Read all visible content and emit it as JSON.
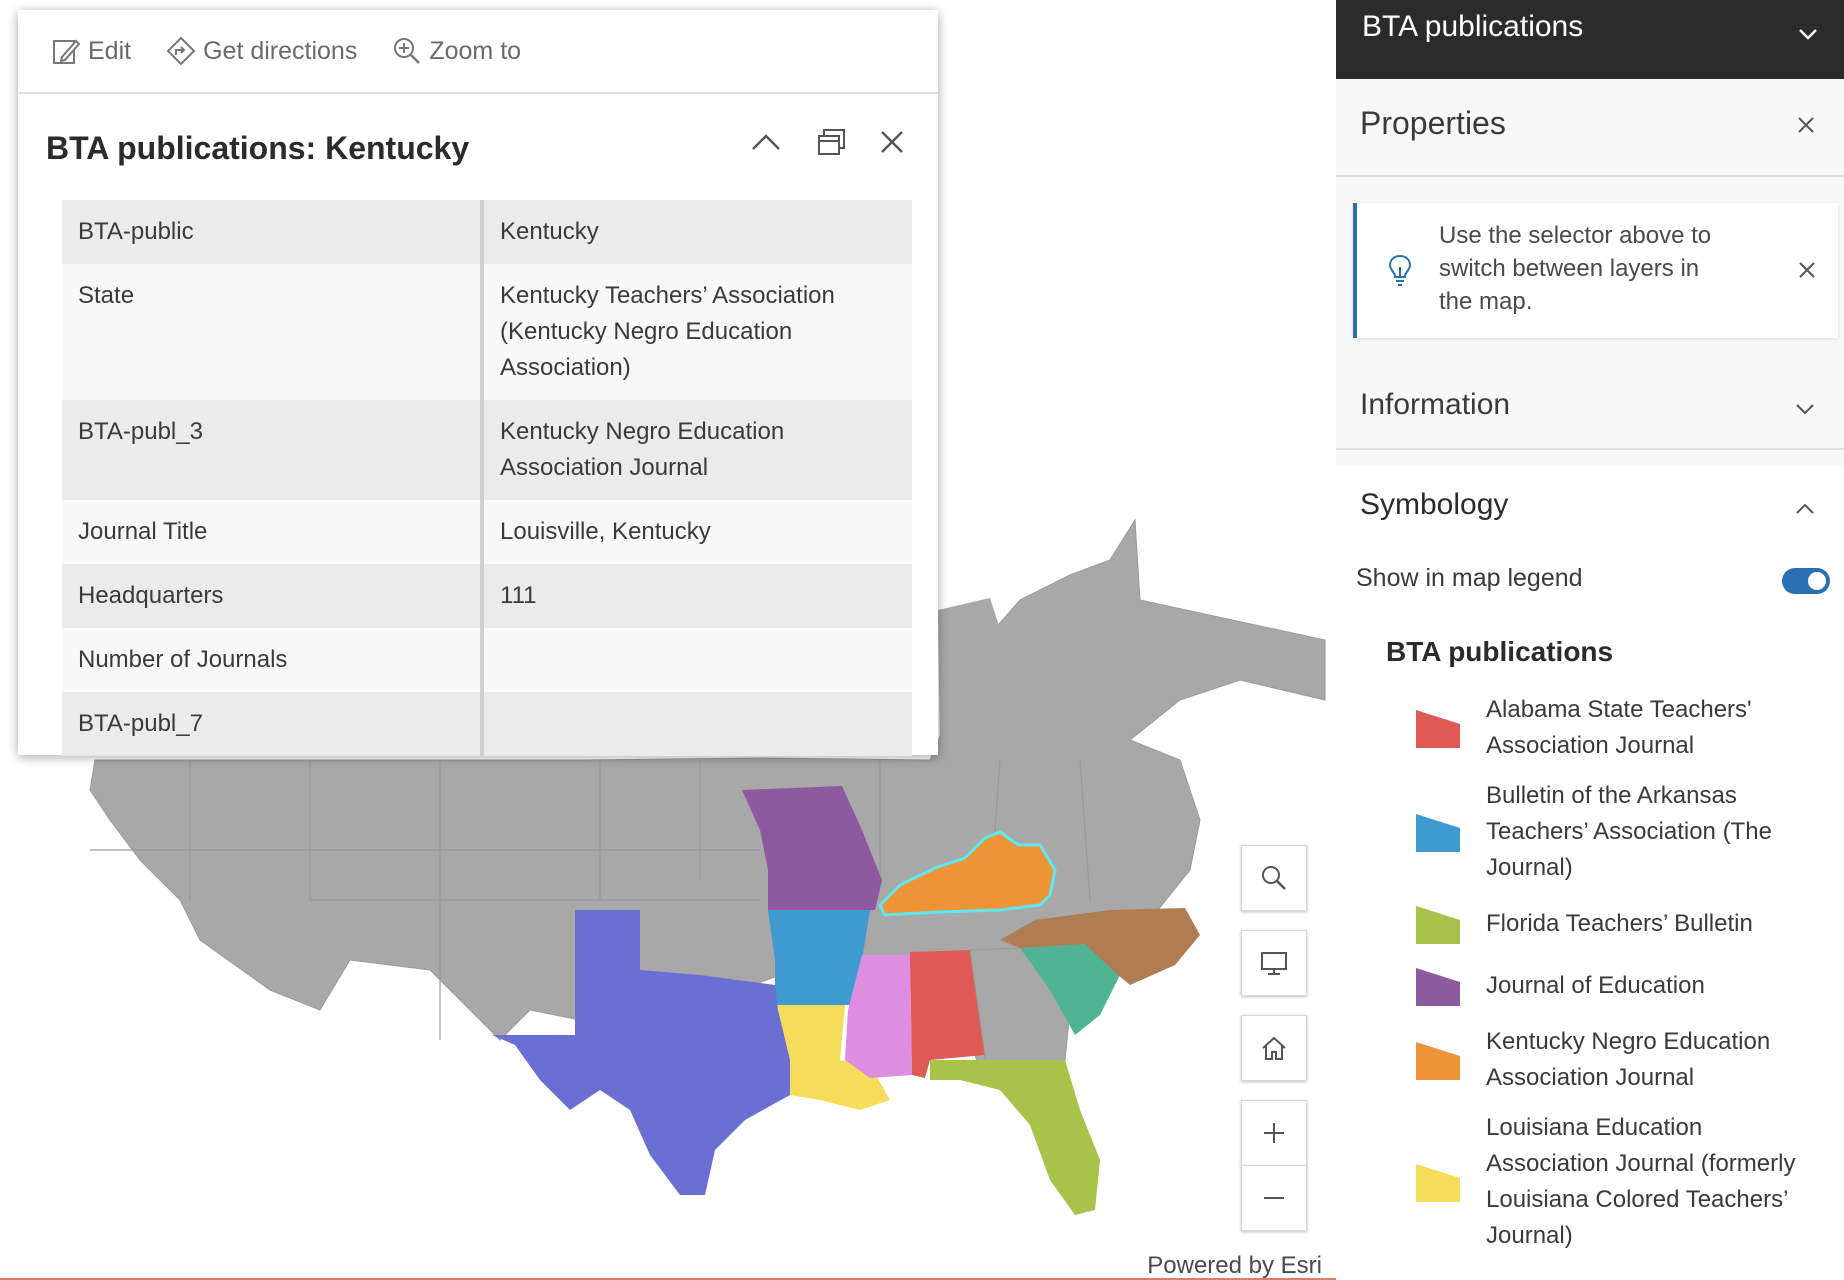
{
  "popup": {
    "actions": {
      "edit": "Edit",
      "directions": "Get directions",
      "zoom": "Zoom to"
    },
    "title": "BTA publications: Kentucky",
    "rows": [
      {
        "key": "BTA-public",
        "value": "Kentucky"
      },
      {
        "key": "State",
        "value": "Kentucky Teachers’ Association (Kentucky Negro Education Association)"
      },
      {
        "key": "BTA-publ_3",
        "value": "Kentucky Negro Education Association Journal"
      },
      {
        "key": "Journal Title",
        "value": "Louisville, Kentucky"
      },
      {
        "key": "Headquarters",
        "value": "111"
      },
      {
        "key": "Number of Journals",
        "value": ""
      },
      {
        "key": "BTA-publ_7",
        "value": ""
      }
    ]
  },
  "map": {
    "attribution": "Powered by Esri",
    "controls": [
      "search-icon",
      "monitor-icon",
      "home-icon",
      "plus-icon",
      "minus-icon"
    ],
    "base_color": "#a8a8a8",
    "highlight_outline": "#5ee8f0"
  },
  "panel": {
    "layer_selector": "BTA publications",
    "properties": "Properties",
    "tip": "Use the selector above to switch between layers in the map.",
    "information": "Information",
    "symbology": "Symbology",
    "show_in_legend": "Show in map legend",
    "show_in_legend_on": true,
    "legend_title": "BTA publications",
    "legend": [
      {
        "label": "Alabama State Teachers' Association Journal",
        "color": "#e05a55"
      },
      {
        "label": "Bulletin of the Arkansas Teachers’ Association (The Journal)",
        "color": "#3e9ad0"
      },
      {
        "label": "Florida Teachers’ Bulletin",
        "color": "#a8c24a"
      },
      {
        "label": "Journal of Education",
        "color": "#8d5aa0"
      },
      {
        "label": "Kentucky Negro Education Association Journal",
        "color": "#ee9438"
      },
      {
        "label": "Louisiana Education Association Journal (formerly Louisiana Colored Teachers’ Journal)",
        "color": "#f5dc5a"
      }
    ]
  }
}
